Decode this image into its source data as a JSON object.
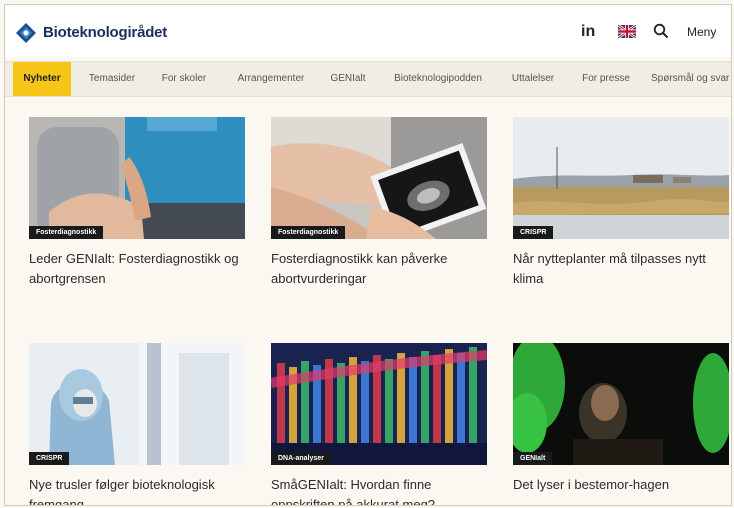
{
  "header": {
    "site_name": "Bioteknologirådet",
    "linkedin_label": "in",
    "menu_label": "Meny"
  },
  "nav": {
    "tabs": [
      {
        "label": "Nyheter",
        "active": true
      },
      {
        "label": "Temasider"
      },
      {
        "label": "For skoler"
      },
      {
        "label": "Arrangementer"
      },
      {
        "label": "GENIalt"
      },
      {
        "label": "Bioteknologipodden"
      },
      {
        "label": "Uttalelser"
      },
      {
        "label": "For presse"
      },
      {
        "label": "Spørsmål og svar"
      }
    ]
  },
  "cards": [
    {
      "badge": "Fosterdiagnostikk",
      "title": "Leder GENIalt: Fosterdiagnostikk og abortgrensen"
    },
    {
      "badge": "Fosterdiagnostikk",
      "title": "Fosterdiagnostikk kan påverke abortvurderingar"
    },
    {
      "badge": "CRISPR",
      "title": "Når nytteplanter må tilpasses nytt klima"
    },
    {
      "badge": "CRISPR",
      "title": "Nye trusler følger bioteknologisk fremgang"
    },
    {
      "badge": "DNA-analyser",
      "title": "SmåGENIalt: Hvordan finne oppskriften på akkurat meg?"
    },
    {
      "badge": "GENIalt",
      "title": "Det lyser i bestemor-hagen"
    }
  ],
  "colors": {
    "accent": "#f5c518",
    "brand": "#1b2d5a",
    "background": "#fbf8f1"
  }
}
